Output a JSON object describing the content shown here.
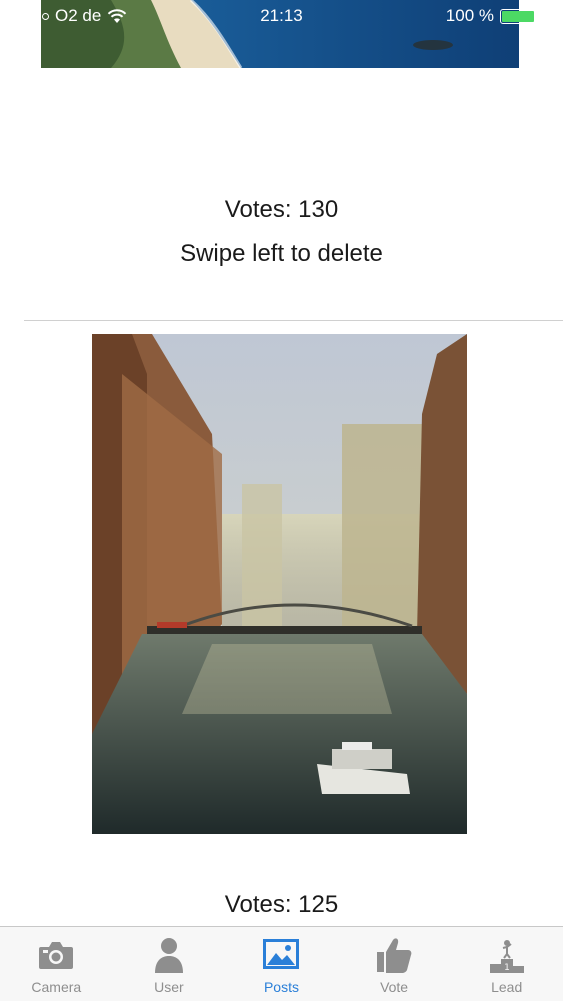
{
  "status_bar": {
    "carrier": "O2 de",
    "time": "21:13",
    "battery": "100 %"
  },
  "posts": [
    {
      "votes": "Votes: 130",
      "hint": "Swipe left to delete"
    },
    {
      "votes": "Votes: 125"
    }
  ],
  "tabs": [
    {
      "label": "Camera",
      "icon": "camera-icon"
    },
    {
      "label": "User",
      "icon": "user-icon"
    },
    {
      "label": "Posts",
      "icon": "posts-icon",
      "active": true
    },
    {
      "label": "Vote",
      "icon": "thumbs-up-icon"
    },
    {
      "label": "Lead",
      "icon": "podium-icon"
    }
  ],
  "colors": {
    "accent": "#2a7fd8",
    "inactive": "#8e8e8e",
    "battery": "#4cd964"
  }
}
